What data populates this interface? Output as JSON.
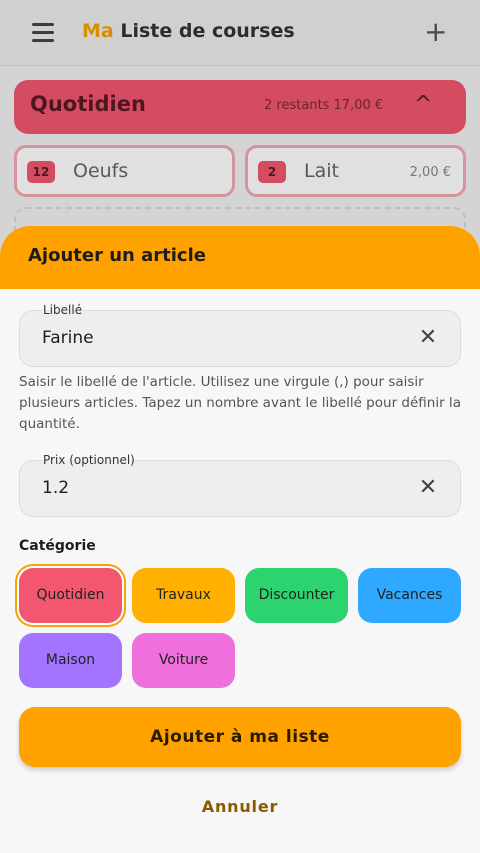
{
  "app": {
    "title_accent": "Ma",
    "title_rest": " Liste de courses",
    "menu_icon": "menu-icon",
    "add_icon": "plus-icon"
  },
  "category_header": {
    "name": "Quotidien",
    "meta": "2 restants  17,00 €",
    "icon": "chevron-up-icon",
    "color": "#f2576f"
  },
  "items": [
    {
      "qty": "12",
      "name": "Oeufs",
      "price": ""
    },
    {
      "qty": "2",
      "name": "Lait",
      "price": "2,00 €"
    }
  ],
  "sheet": {
    "title": "Ajouter un article",
    "label_field": {
      "label": "Libellé",
      "value": "Farine",
      "clear_icon": "close-icon"
    },
    "helper": "Saisir le libellé de l'article. Utilisez une virgule (,) pour saisir plusieurs articles. Tapez un nombre avant le libellé pour définir la quantité.",
    "price_field": {
      "label": "Prix (optionnel)",
      "value": "1.2",
      "clear_icon": "close-icon"
    },
    "category_label": "Catégorie",
    "categories": [
      {
        "label": "Quotidien",
        "color": "#f2576f",
        "selected": true
      },
      {
        "label": "Travaux",
        "color": "#ffb000",
        "selected": false
      },
      {
        "label": "Discounter",
        "color": "#2dd36f",
        "selected": false
      },
      {
        "label": "Vacances",
        "color": "#2fa8ff",
        "selected": false
      },
      {
        "label": "Maison",
        "color": "#a374ff",
        "selected": false
      },
      {
        "label": "Voiture",
        "color": "#ef6fdc",
        "selected": false
      }
    ],
    "submit_label": "Ajouter à ma liste",
    "cancel_label": "Annuler"
  },
  "colors": {
    "accent": "#ffa200",
    "selected_ring": "#f5a300"
  }
}
